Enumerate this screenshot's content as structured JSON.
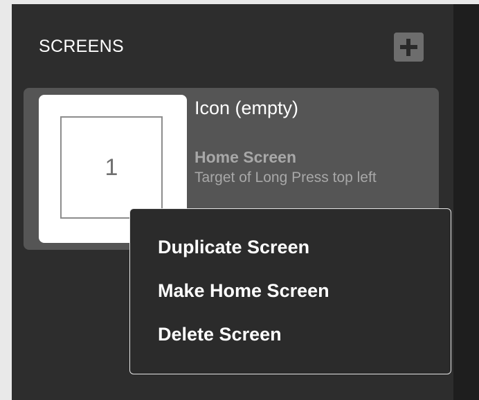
{
  "sidebar": {
    "title": "SCREENS",
    "add_button": {
      "icon": "plus-icon"
    }
  },
  "screens": [
    {
      "thumbnail_number": "1",
      "name": "Icon (empty)",
      "role": "Home Screen",
      "description": "Target of Long Press top left"
    }
  ],
  "context_menu": {
    "items": [
      {
        "label": "Duplicate Screen"
      },
      {
        "label": "Make Home Screen"
      },
      {
        "label": "Delete Screen"
      }
    ]
  },
  "colors": {
    "panel_bg": "#2d2d2d",
    "card_bg": "#555555",
    "menu_border": "#e6e6e6",
    "secondary_text": "#a8a8a8"
  }
}
